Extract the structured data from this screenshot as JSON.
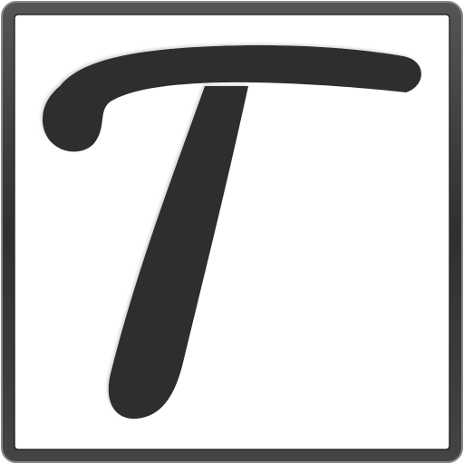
{
  "icon": {
    "glyph": "T",
    "glyph_style": "handwritten-script",
    "frame_color": "#3a3a3a",
    "frame_highlight": "#8a8a8a",
    "background_color": "#ffffff",
    "glyph_color": "#2e2e2e",
    "glyph_highlight": "#bdbdbd"
  }
}
